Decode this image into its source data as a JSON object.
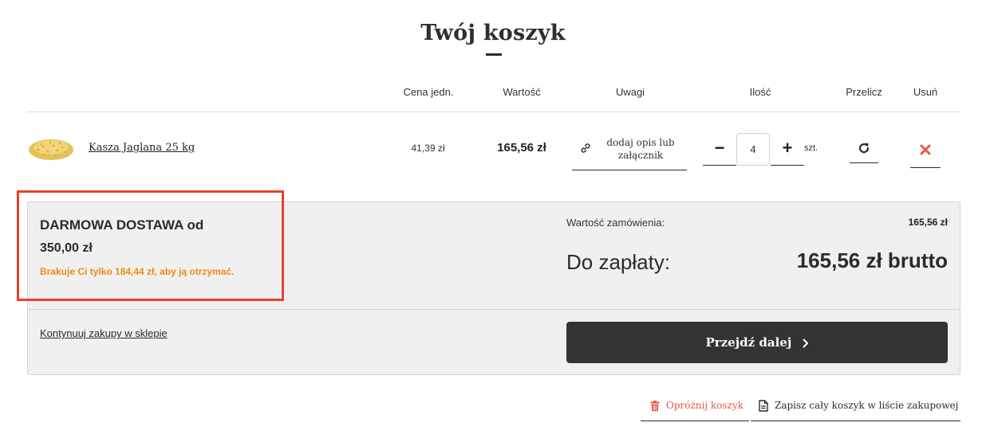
{
  "page": {
    "title": "Twój koszyk"
  },
  "table": {
    "headers": {
      "unit_price": "Cena jedn.",
      "value": "Wartość",
      "notes": "Uwagi",
      "quantity": "Ilość",
      "recalculate": "Przelicz",
      "remove": "Usuń"
    },
    "items": [
      {
        "name": "Kasza Jaglana 25 kg",
        "unit_price": "41,39 zł",
        "value": "165,56 zł",
        "notes_link": "dodaj opis lub załącznik",
        "quantity": "4",
        "unit": "szt.",
        "minus_label": "−",
        "plus_label": "+"
      }
    ]
  },
  "summary": {
    "free_shipping_title": "DARMOWA DOSTAWA od",
    "free_shipping_amount": "350,00 zł",
    "free_shipping_missing": "Brakuje Ci tylko 184,44 zł, aby ją otrzymać.",
    "order_value_label": "Wartość zamówienia:",
    "order_value": "165,56 zł",
    "to_pay_label": "Do zapłaty:",
    "to_pay_value": "165,56 zł brutto",
    "continue_label": "Kontynuuj zakupy w sklepie",
    "next_label": "Przejdź dalej"
  },
  "footer_actions": {
    "empty_cart": "Opróżnij koszyk",
    "save_list": "Zapisz cały koszyk w liście zakupowej"
  },
  "colors": {
    "accent_dark": "#333333",
    "warning_orange": "#f08a12",
    "remove_red": "#e05a4a",
    "highlight_red": "#e8432a"
  },
  "icons": {
    "product": "millet-grain-image",
    "notes": "link-icon",
    "recalculate": "refresh-icon",
    "remove": "close-x-icon",
    "next": "chevron-right-icon",
    "empty_cart": "trash-icon",
    "save_list": "document-icon"
  }
}
